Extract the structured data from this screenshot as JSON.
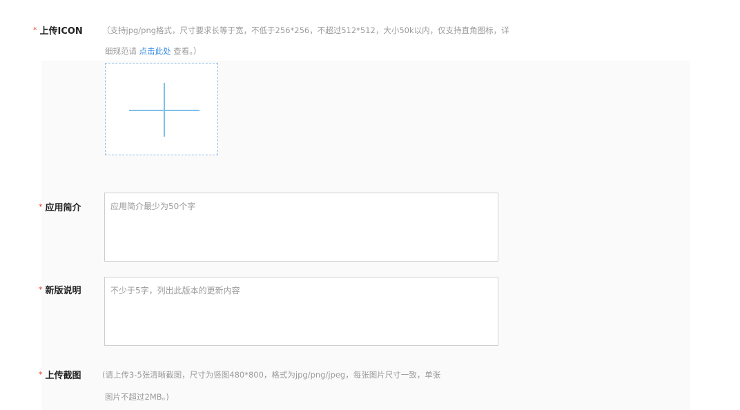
{
  "required_mark": "*",
  "icon_section": {
    "label": "上传ICON",
    "hint_line1": "（支持jpg/png格式，尺寸要求长等于宽，不低于256*256，不超过512*512，大小50k以内，仅支持直角图标，详",
    "hint_line2_pre": "细规范请 ",
    "hint_link": "点击此处",
    "hint_line2_post": " 查看。）",
    "upload_icon": "plus-icon"
  },
  "intro_section": {
    "label": "应用简介",
    "placeholder": "应用简介最少为50个字"
  },
  "release_notes_section": {
    "label": "新版说明",
    "placeholder": "不少于5字，列出此版本的更新内容"
  },
  "screenshots_section": {
    "label": "上传截图",
    "hint_line1": "(请上传3-5张清晰截图，尺寸为竖图480*800，格式为jpg/png/jpeg，每张图片尺寸一致，单张",
    "hint_line2": "图片不超过2MB。)"
  },
  "colors": {
    "required": "#e8402a",
    "link": "#3a8ee6",
    "plus": "#7fc0ea",
    "upload_border": "#8ebbe0"
  }
}
